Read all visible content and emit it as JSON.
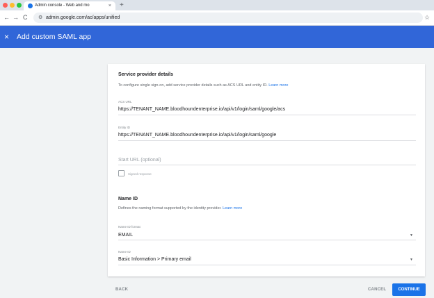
{
  "browser": {
    "tab_title": "Admin console - Web and mo",
    "tab_close": "×",
    "new_tab": "+",
    "nav_back": "←",
    "nav_forward": "→",
    "nav_reload": "C",
    "omnibox_icon": "⚙",
    "url": "admin.google.com/ac/apps/unified",
    "star": "☆"
  },
  "header": {
    "close_glyph": "×",
    "title": "Add custom SAML app",
    "color": "#3166d8"
  },
  "service_provider": {
    "heading": "Service provider details",
    "description": "To configure single sign-on, add service provider details such as ACS URL and entity ID.",
    "learn_more": "Learn more",
    "acs_label": "ACS URL",
    "acs_value": "https://TENANT_NAME.bloodhoundenterprise.io/api/v1/login/saml/google/acs",
    "entity_label": "Entity ID",
    "entity_value": "https://TENANT_NAME.bloodhoundenterprise.io/api/v1/login/saml/google",
    "start_url_placeholder": "Start URL (optional)",
    "signed_response_label": "Signed response",
    "signed_response_checked": false
  },
  "name_id": {
    "heading": "Name ID",
    "description": "Defines the naming format supported by the identity provider.",
    "learn_more": "Learn more",
    "format_label": "Name ID format",
    "format_value": "EMAIL",
    "nameid_label": "Name ID",
    "nameid_value": "Basic Information > Primary email",
    "dropdown_caret": "▼"
  },
  "footer": {
    "back": "BACK",
    "cancel": "CANCEL",
    "continue": "CONTINUE"
  }
}
